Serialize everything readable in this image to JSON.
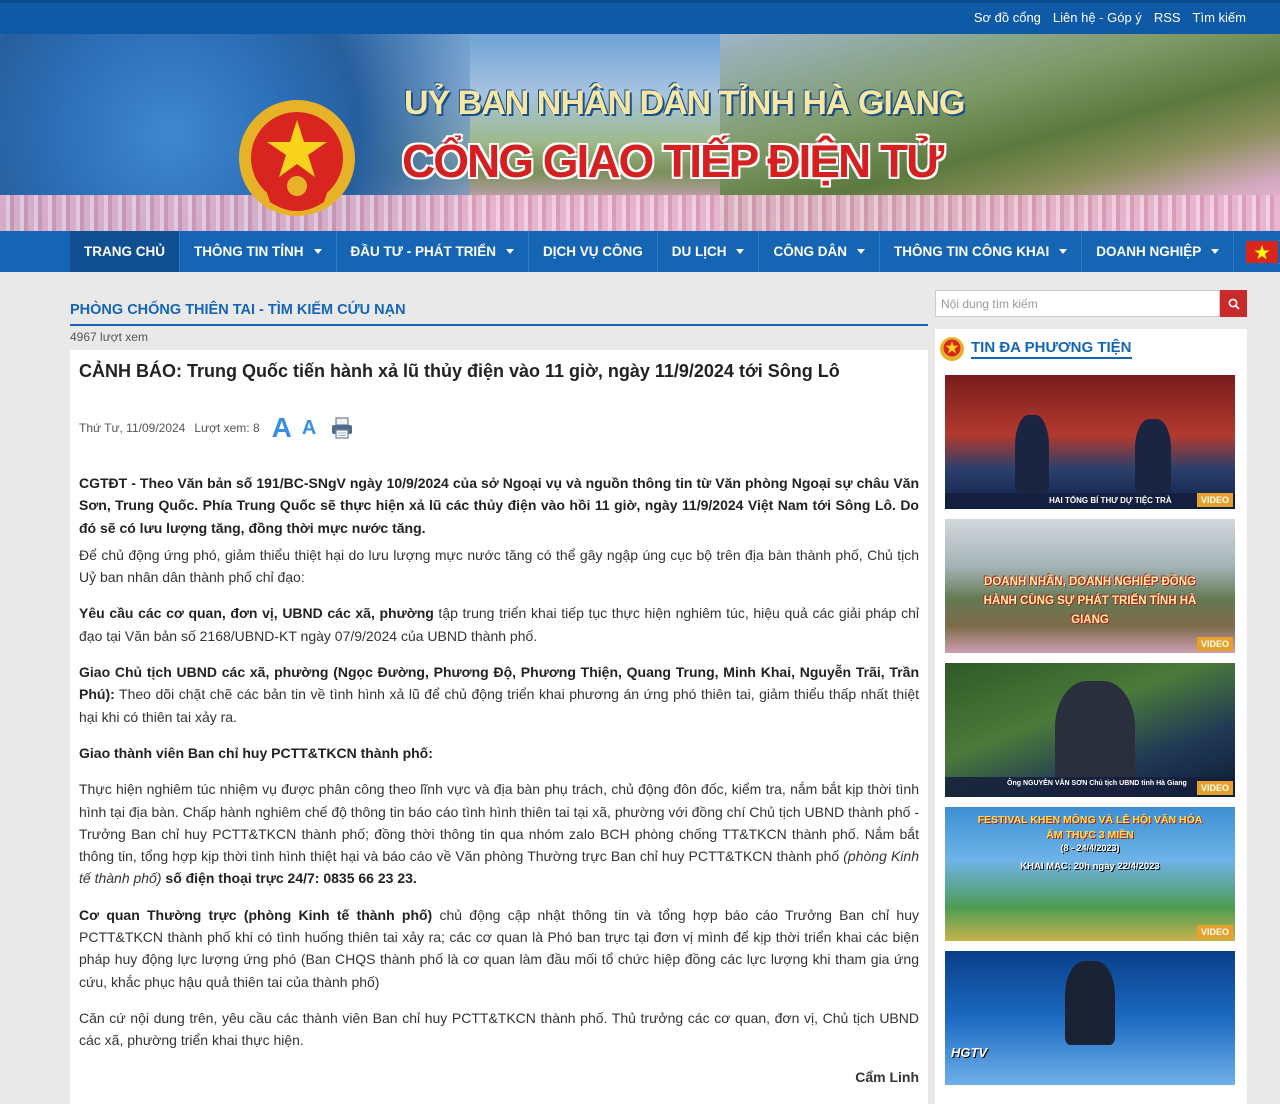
{
  "topbar": {
    "links": [
      "Sơ đồ cổng",
      "Liên hệ - Góp ý",
      "RSS",
      "Tìm kiếm"
    ]
  },
  "banner": {
    "line1": "UỶ BAN NHÂN DÂN TỈNH HÀ GIANG",
    "line2": "CỔNG GIAO TIẾP ĐIỆN TỬ"
  },
  "nav": {
    "items": [
      {
        "label": "TRANG CHỦ"
      },
      {
        "label": "THÔNG TIN TỈNH"
      },
      {
        "label": "ĐẦU TƯ - PHÁT TRIỂN"
      },
      {
        "label": "DỊCH VỤ CÔNG"
      },
      {
        "label": "DU LỊCH"
      },
      {
        "label": "CÔNG DÂN"
      },
      {
        "label": "THÔNG TIN CÔNG KHAI"
      },
      {
        "label": "DOANH NGHIỆP"
      }
    ]
  },
  "category": {
    "title": "PHÒNG CHỐNG THIÊN TAI - TÌM KIẾM CỨU NẠN",
    "views": "4967 lượt xem"
  },
  "article": {
    "title": "CẢNH BÁO: Trung Quốc tiến hành xả lũ thủy điện vào 11 giờ, ngày 11/9/2024 tới Sông Lô",
    "date": "Thứ Tư, 11/09/2024",
    "views": "Lượt xem: 8",
    "font_big": "A",
    "font_small": "A",
    "lead": "CGTĐT - Theo Văn bản số 191/BC-SNgV ngày 10/9/2024 của sở Ngoại vụ và nguồn thông tin từ Văn phòng Ngoại sự châu Văn Sơn, Trung Quốc. Phía Trung Quốc sẽ thực hiện xả lũ các thủy điện vào hồi 11 giờ, ngày 11/9/2024 Việt Nam tới Sông Lô. Do đó sẽ có lưu lượng tăng, đồng thời mực nước tăng.",
    "p1": "Để chủ động ứng phó, giảm thiểu thiệt hại do lưu lượng mực nước tăng có thể gây ngập úng cục bộ trên địa bàn thành phố, Chủ tịch Uỷ ban nhân dân thành phố chỉ đạo:",
    "p2_bold": "Yêu cầu các cơ quan, đơn vị, UBND các xã, phường",
    "p2_rest": " tập trung triển khai tiếp tục thực hiện nghiêm túc, hiệu quả các giải pháp chỉ đạo tại Văn bản số 2168/UBND-KT ngày 07/9/2024 của UBND thành phố.",
    "p3_bold": "Giao Chủ tịch UBND các xã, phường (Ngọc Đường, Phương Độ, Phương Thiện, Quang Trung, Minh Khai, Nguyễn Trãi, Trần Phú):",
    "p3_rest": " Theo dõi chặt chẽ các bản tin về tình hình xả lũ để chủ động triển khai phương án ứng phó thiên tai, giảm thiểu thấp nhất thiệt hại khi có thiên tai xảy ra.",
    "p4_bold": "Giao thành viên Ban chỉ huy PCTT&TKCN thành phố:",
    "p5_text": "Thực hiện nghiêm túc nhiệm vụ được phân công theo lĩnh vực và địa bàn phụ trách, chủ động đôn đốc, kiểm tra, nắm bắt kịp thời tình hình tại địa bàn. Chấp hành nghiêm chế độ thông tin báo cáo tình hình thiên tai tại xã, phường với đồng chí Chủ tịch UBND thành phố - Trưởng Ban chỉ huy PCTT&TKCN thành phố; đồng thời thông tin qua nhóm zalo BCH phòng chống TT&TKCN thành phố. Nắm bắt thông tin, tổng hợp kịp thời tình hình thiệt hại và báo cáo về Văn phòng Thường trực Ban chỉ huy PCTT&TKCN thành phố",
    "p5_italic": " (phòng Kinh tế thành phố)",
    "p5_bold": " số điện thoại trực 24/7: 0835 66 23 23.",
    "p6_bold": "Cơ quan Thường trực (phòng Kinh tế thành phố)",
    "p6_rest": " chủ động cập nhật thông tin và tổng hợp báo cáo Trưởng Ban chỉ huy PCTT&TKCN thành phố khi có tình huống thiên tai xảy ra; các cơ quan là Phó ban trực tại đơn vị mình để kịp thời triển khai các biện pháp huy động lực lượng ứng phó (Ban CHQS thành phố là cơ quan làm đầu mối tổ chức hiệp đồng các lực lượng khi tham gia ứng cứu, khắc phục hậu quả thiên tai của thành phố)",
    "p7": "Căn cứ nội dung trên, yêu cầu các thành viên Ban chỉ huy PCTT&TKCN thành phố. Thủ trưởng các cơ quan, đơn vị, Chủ tịch UBND các xã, phường triển khai thực hiện.",
    "author": "Cẩm Linh"
  },
  "sidebar": {
    "search_placeholder": "Nội dung tìm kiếm",
    "media_title": "TIN ĐA PHƯƠNG TIỆN",
    "videos": [
      {
        "tag": "VIDEO",
        "caption": "HAI TỔNG BÍ THƯ DỰ TIỆC TRÀ"
      },
      {
        "tag": "VIDEO",
        "caption": "DOANH NHÂN, DOANH NGHIỆP ĐỒNG HÀNH CÙNG SỰ PHÁT TRIỂN TỈNH HÀ GIANG"
      },
      {
        "tag": "VIDEO",
        "caption": "Ông NGUYỄN VĂN SƠN Chủ tịch UBND tỉnh Hà Giang"
      },
      {
        "tag": "VIDEO",
        "caption_top": "FESTIVAL KHEN MÔNG VÀ LỄ HỘI VĂN HÓA ẨM THỰC 3 MIỀN",
        "caption_date": "(8 - 24/4/2023)",
        "caption_bottom": "KHAI MẠC: 20h ngày 22/4/2023"
      },
      {
        "tag": "",
        "caption": "HGTV"
      }
    ]
  },
  "colors": {
    "nav": "#1565b4",
    "accent_red": "#c82b2b",
    "video_tag": "#e6a12a"
  }
}
